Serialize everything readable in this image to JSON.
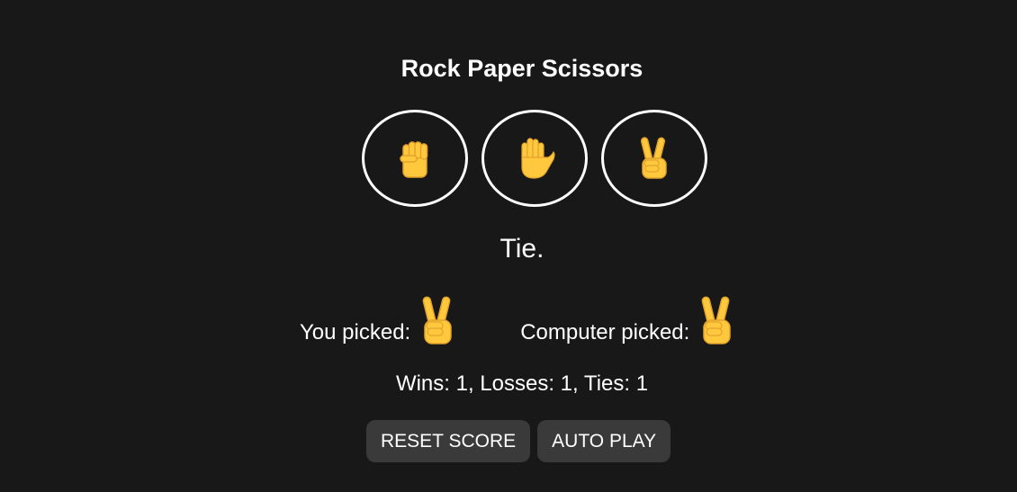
{
  "title": "Rock Paper Scissors",
  "moves": [
    {
      "name": "rock",
      "icon": "raised-fist-icon"
    },
    {
      "name": "paper",
      "icon": "raised-hand-icon"
    },
    {
      "name": "scissors",
      "icon": "victory-hand-icon"
    }
  ],
  "result": "Tie.",
  "picks": {
    "you_label": "You picked:",
    "you_icon": "victory-hand-icon",
    "computer_label": "Computer picked:",
    "computer_icon": "victory-hand-icon"
  },
  "score": "Wins: 1, Losses: 1, Ties: 1",
  "buttons": {
    "reset": "RESET SCORE",
    "auto_play": "AUTO PLAY"
  },
  "colors": {
    "background": "#181818",
    "text": "#ffffff",
    "button_bg": "#3a3a3a",
    "emoji_yellow": "#FFC83D",
    "emoji_outline": "#E3A32B"
  }
}
